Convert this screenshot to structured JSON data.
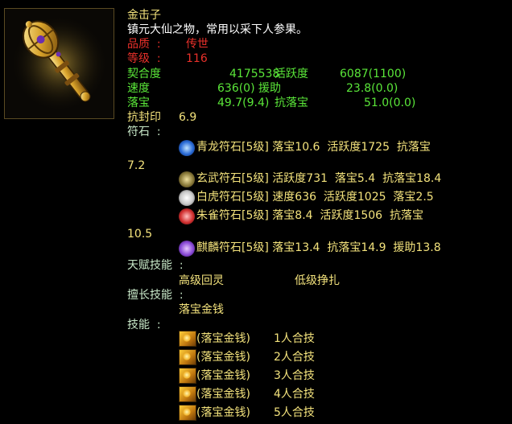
{
  "item": {
    "name": "金击子",
    "desc": "镇元大仙之物，常用以采下人参果。",
    "quality_label": "品质  :",
    "quality_value": "传世",
    "level_label": "等级  :",
    "level_value": "116"
  },
  "stats": [
    {
      "label": "契合度",
      "value": "4175538",
      "label2": "活跃度",
      "value2": "6087(1100)"
    },
    {
      "label": "速度",
      "value": "636(0)",
      "label2": "援助",
      "value2": "23.8(0.0)"
    },
    {
      "label": "落宝",
      "value": "49.7(9.4)",
      "label2": "抗落宝",
      "value2": "51.0(0.0)"
    }
  ],
  "seal": {
    "label": "抗封印",
    "value": "6.9"
  },
  "runes": {
    "label": "符石  :",
    "items": [
      {
        "text": "青龙符石[5级] 落宝10.6  活跃度1725  抗落宝",
        "wrap": "7.2",
        "color": "#2a6bd6"
      },
      {
        "text": "玄武符石[5级] 活跃度731  落宝5.4  抗落宝18.4",
        "color": "#8a7a3a"
      },
      {
        "text": "白虎符石[5级] 速度636  活跃度1025  落宝2.5",
        "color": "#c8c8c8"
      },
      {
        "text": "朱雀符石[5级] 落宝8.4  活跃度1506  抗落宝",
        "wrap": "10.5",
        "color": "#d23030"
      },
      {
        "text": "麒麟符石[5级] 落宝13.4  抗落宝14.9  援助13.8",
        "color": "#8a4ad6"
      }
    ]
  },
  "talent": {
    "label": "天赋技能  :",
    "skills": [
      "高级回灵",
      "低级挣扎"
    ]
  },
  "specialty": {
    "label": "擅长技能  :",
    "skill": "落宝金钱"
  },
  "skills": {
    "label": "技能  :",
    "items": [
      {
        "name": "(落宝金钱)",
        "combo": "1人合技"
      },
      {
        "name": "(落宝金钱)",
        "combo": "2人合技"
      },
      {
        "name": "(落宝金钱)",
        "combo": "3人合技"
      },
      {
        "name": "(落宝金钱)",
        "combo": "4人合技"
      },
      {
        "name": "(落宝金钱)",
        "combo": "5人合技"
      }
    ]
  }
}
